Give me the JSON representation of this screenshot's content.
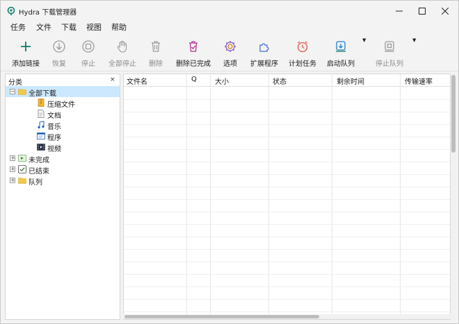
{
  "window": {
    "title": "Hydra 下载管理器"
  },
  "menu": [
    {
      "label": "任务"
    },
    {
      "label": "文件"
    },
    {
      "label": "下载"
    },
    {
      "label": "视图"
    },
    {
      "label": "帮助"
    }
  ],
  "toolbar": {
    "add": "添加链接",
    "resume": "恢复",
    "stop": "停止",
    "stop_all": "全部停止",
    "delete": "删除",
    "delete_completed": "删除已完成",
    "options": "选项",
    "extensions": "扩展程序",
    "scheduler": "计划任务",
    "start_queue": "启动队列",
    "stop_queue": "停止队列"
  },
  "sidebar": {
    "title": "分类",
    "close": "×",
    "items": [
      {
        "label": "全部下载",
        "icon": "folder-open-icon"
      },
      {
        "label": "压缩文件",
        "icon": "archive-icon"
      },
      {
        "label": "文档",
        "icon": "document-icon"
      },
      {
        "label": "音乐",
        "icon": "music-icon"
      },
      {
        "label": "程序",
        "icon": "program-icon"
      },
      {
        "label": "视频",
        "icon": "video-icon"
      },
      {
        "label": "未完成",
        "icon": "unfinished-icon"
      },
      {
        "label": "已结束",
        "icon": "finished-icon"
      },
      {
        "label": "队列",
        "icon": "queue-folder-icon"
      }
    ]
  },
  "grid": {
    "columns": [
      "文件名",
      "Q",
      "大小",
      "状态",
      "剩余时间",
      "传输速率"
    ]
  },
  "colors": {
    "accent": "#0f7b6c",
    "selection": "#cce8ff"
  }
}
